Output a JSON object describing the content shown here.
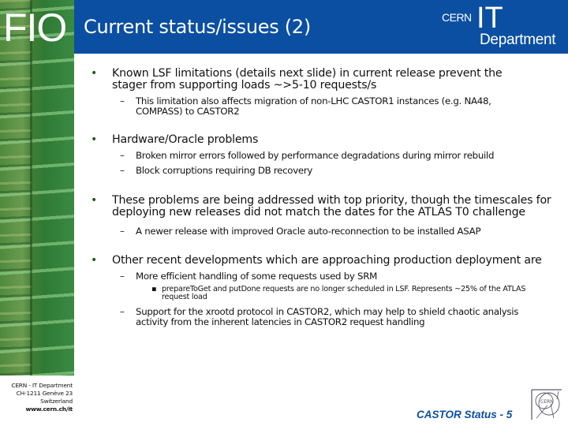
{
  "sidebar": {
    "logo_text": "FIO",
    "address": {
      "line1": "CERN - IT Department",
      "line2": "CH-1211 Genève 23",
      "line3": "Switzerland",
      "url": "www.cern.ch/it"
    }
  },
  "header": {
    "title": "Current status/issues (2)",
    "logo": {
      "cern": "CERN",
      "it": "IT",
      "department": "Department"
    },
    "background_color": "#0b4fa2"
  },
  "content": {
    "bullets": [
      {
        "text": "Known LSF limitations (details next slide) in current release prevent the stager from supporting loads ~>5-10 requests/s",
        "sub": [
          {
            "text": "This limitation also affects migration of non-LHC CASTOR1 instances (e.g. NA48, COMPASS) to CASTOR2",
            "sub": []
          }
        ]
      },
      {
        "text": "Hardware/Oracle problems",
        "sub": [
          {
            "text": "Broken mirror errors followed by performance degradations during mirror rebuild",
            "sub": []
          },
          {
            "text": "Block corruptions requiring DB recovery",
            "sub": []
          }
        ]
      },
      {
        "text": "These problems are being addressed with top priority, though the timescales for deploying new releases did not match the dates for the ATLAS T0 challenge",
        "sub": [
          {
            "text": "A newer release with improved Oracle auto-reconnection to be installed ASAP",
            "sub": []
          }
        ]
      },
      {
        "text": "Other recent developments which are approaching production deployment are",
        "sub": [
          {
            "text": "More efficient handling of some requests used by SRM",
            "sub": [
              {
                "text": "prepareToGet and putDone requests are no longer scheduled in LSF. Represents ~25% of the ATLAS request load"
              }
            ]
          },
          {
            "text": "Support for the xrootd protocol in CASTOR2, which may help to shield chaotic analysis activity from the inherent latencies in CASTOR2 request handling",
            "sub": []
          }
        ]
      }
    ],
    "bullet_glyph": "•",
    "dash_glyph": "–",
    "square_glyph": "▪"
  },
  "footer": {
    "slide_label": "CASTOR Status - 5",
    "accent_color": "#0b4fa2"
  }
}
